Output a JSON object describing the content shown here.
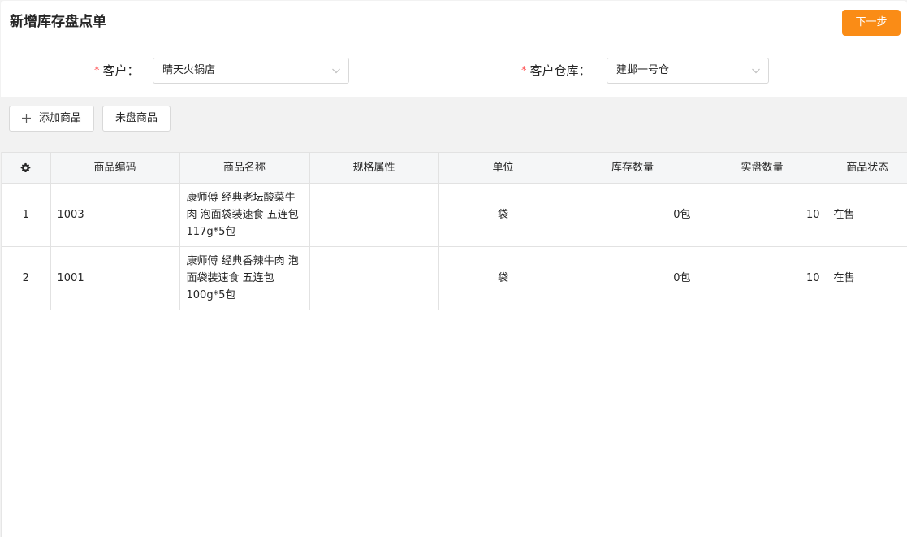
{
  "header": {
    "title": "新增库存盘点单",
    "next_button": "下一步"
  },
  "form": {
    "customer": {
      "required_mark": "*",
      "label": "客户：",
      "value": "晴天火锅店"
    },
    "warehouse": {
      "required_mark": "*",
      "label": "客户仓库：",
      "value": "建邺一号仓"
    }
  },
  "toolbar": {
    "add_product": "添加商品",
    "uncounted_products": "未盘商品"
  },
  "table": {
    "columns": [
      "商品编码",
      "商品名称",
      "规格属性",
      "单位",
      "库存数量",
      "实盘数量",
      "商品状态"
    ],
    "rows": [
      {
        "index": "1",
        "code": "1003",
        "name": "康师傅 经典老坛酸菜牛肉 泡面袋装速食 五连包 117g*5包",
        "spec": "",
        "unit": "袋",
        "stock_qty": "0包",
        "actual_qty": "10",
        "status": "在售"
      },
      {
        "index": "2",
        "code": "1001",
        "name": "康师傅 经典香辣牛肉 泡面袋装速食 五连包 100g*5包",
        "spec": "",
        "unit": "袋",
        "stock_qty": "0包",
        "actual_qty": "10",
        "status": "在售"
      }
    ]
  },
  "colors": {
    "accent": "#fa8c16",
    "required": "#ff4d4f",
    "header_bg": "#f5f6f7"
  }
}
